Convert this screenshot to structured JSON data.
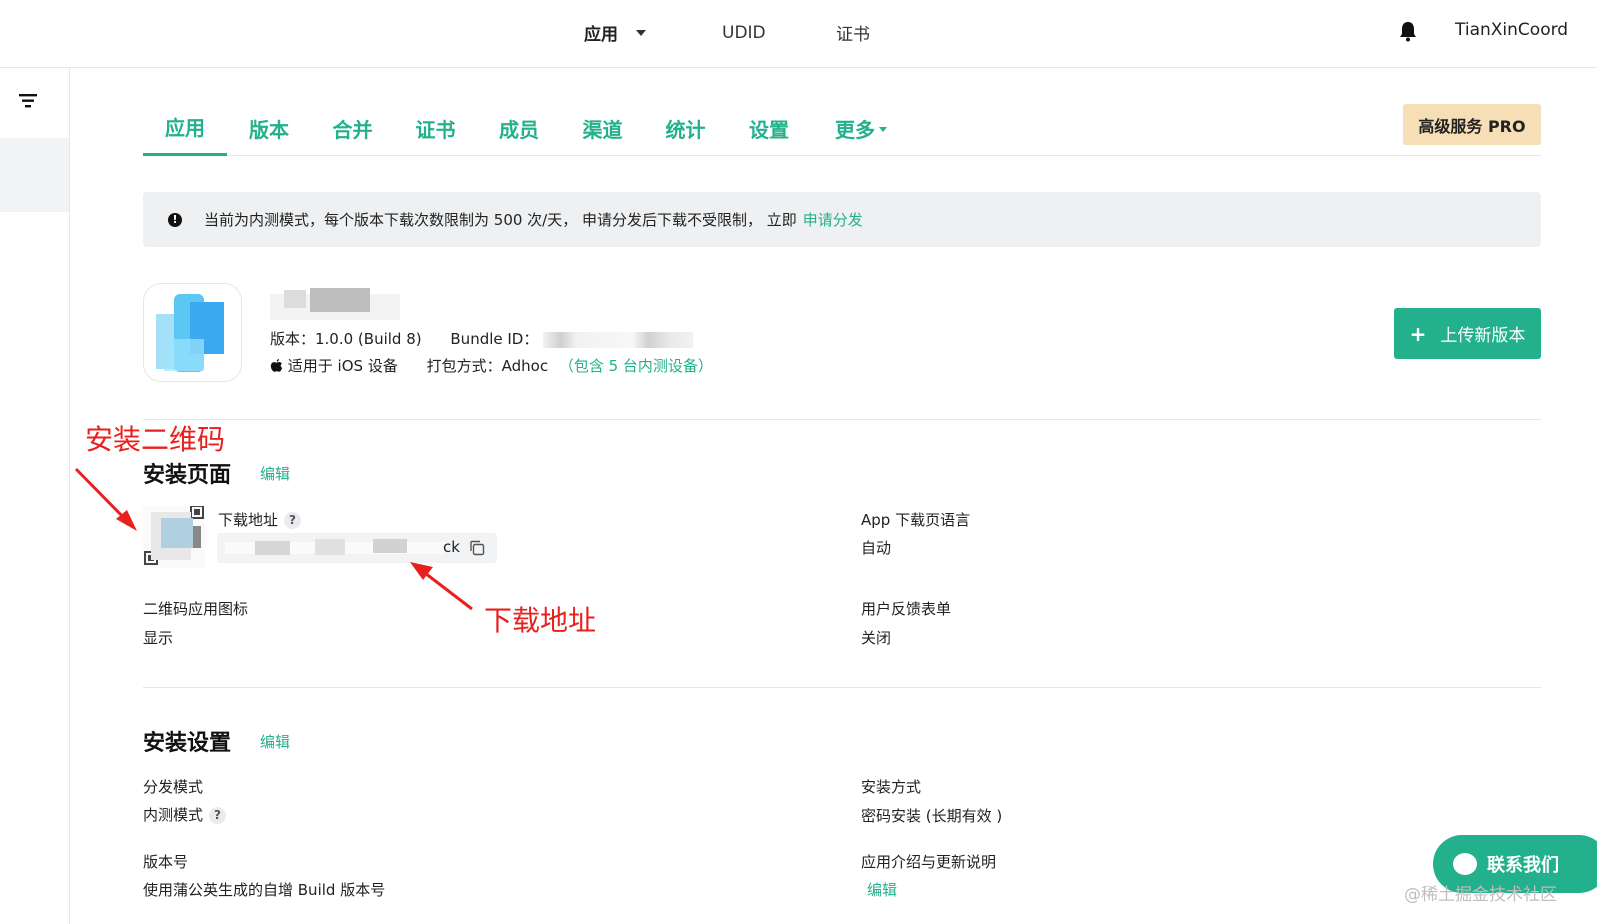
{
  "topbar": {
    "nav": {
      "app": "应用",
      "udid": "UDID",
      "cert": "证书"
    },
    "user": "TianXinCoord"
  },
  "tabs": [
    "应用",
    "版本",
    "合并",
    "证书",
    "成员",
    "渠道",
    "统计",
    "设置",
    "更多"
  ],
  "pro_button": "高级服务 PRO",
  "notice": {
    "text": "当前为内测模式，每个版本下载次数限制为 500 次/天， 申请分发后下载不受限制， 立即",
    "link": "申请分发"
  },
  "app": {
    "version": "版本：1.0.0 (Build 8)",
    "bundle_label": "Bundle ID：",
    "device": "适用于 iOS 设备",
    "package": "打包方式：Adhoc",
    "package_extra": "（包含 5 台内测设备）"
  },
  "upload_button": "上传新版本",
  "install_page": {
    "title": "安装页面",
    "edit": "编辑",
    "download_label": "下载地址",
    "download_tail": "ck",
    "lang_label": "App 下载页语言",
    "lang_value": "自动",
    "qr_icon_label": "二维码应用图标",
    "qr_icon_value": "显示",
    "feedback_label": "用户反馈表单",
    "feedback_value": "关闭"
  },
  "install_settings": {
    "title": "安装设置",
    "edit": "编辑",
    "mode_label": "分发模式",
    "mode_value": "内测模式",
    "method_label": "安装方式",
    "method_value": "密码安装 (长期有效 )",
    "build_label": "版本号",
    "build_value": "使用蒲公英生成的自增 Build 版本号",
    "desc_label": "应用介绍与更新说明",
    "desc_edit": "编辑"
  },
  "annotations": {
    "qr": "安装二维码",
    "download": "下载地址"
  },
  "contact_button": "联系我们",
  "watermark": "@稀土掘金技术社区",
  "help_glyph": "?",
  "colors": {
    "accent": "#23b08c",
    "pro_bg": "#f6dfb7",
    "annotation": "#e8211e"
  }
}
